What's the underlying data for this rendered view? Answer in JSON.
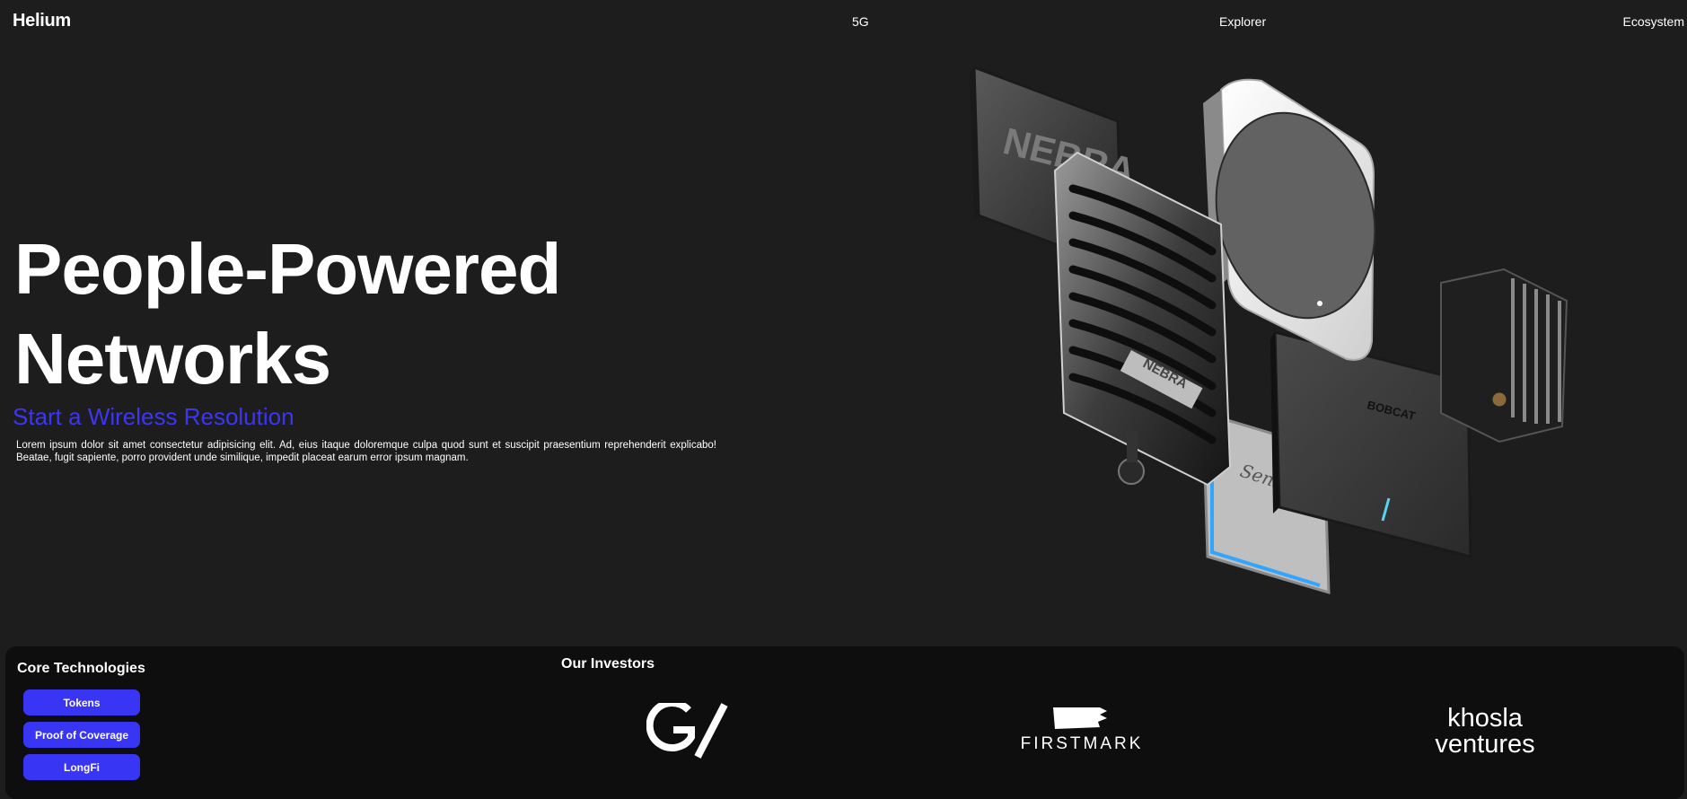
{
  "nav": {
    "brand": "Helium",
    "links": [
      "5G",
      "Explorer",
      "Ecosystem"
    ]
  },
  "hero": {
    "title_line1": "People-Powered",
    "title_line2": "Networks",
    "subtitle": "Start a Wireless Resolution",
    "body": "Lorem ipsum dolor sit amet consectetur adipisicing elit. Ad, eius itaque doloremque culpa quod sunt et suscipit praesentium reprehenderit explicabo! Beatae, fugit sapiente, porro provident unde similique, impedit placeat earum error ipsum magnam."
  },
  "hardware_labels": {
    "nebra_back": "NEBRA",
    "nebra_front": "NEBRA",
    "bobcat": "BOBCAT",
    "sensecap": "SenseCAP"
  },
  "core": {
    "title": "Core Technologies",
    "buttons": [
      "Tokens",
      "Proof of Coverage",
      "LongFi"
    ]
  },
  "investors": {
    "title": "Our Investors",
    "logos": [
      "GV",
      "FIRSTMARK",
      "khosla ventures"
    ],
    "firstmark_text": "FIRSTMARK",
    "khosla_line1": "khosla",
    "khosla_line2": "ventures"
  },
  "colors": {
    "background": "#1d1d1d",
    "panel": "#0e0e0e",
    "accent": "#3935f4",
    "subtitle": "#3d35f5"
  }
}
